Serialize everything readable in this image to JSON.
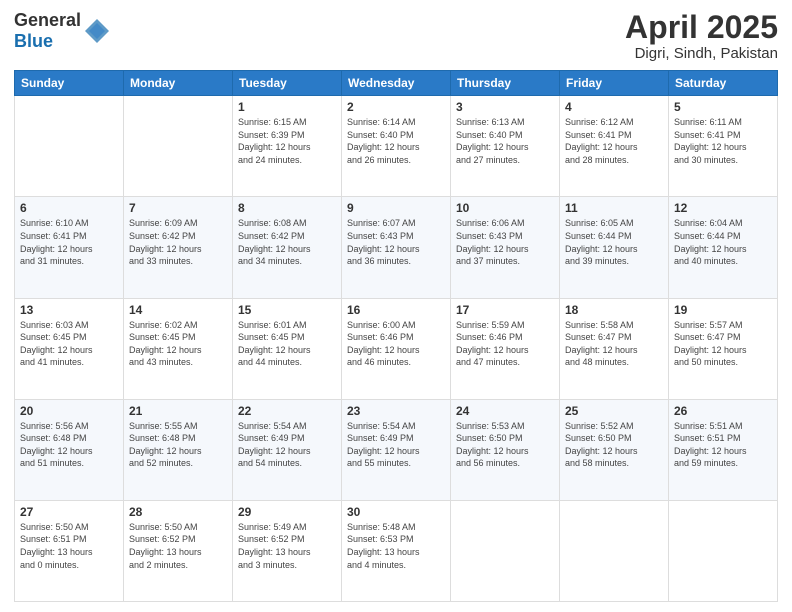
{
  "header": {
    "logo_general": "General",
    "logo_blue": "Blue",
    "title": "April 2025",
    "subtitle": "Digri, Sindh, Pakistan"
  },
  "days_of_week": [
    "Sunday",
    "Monday",
    "Tuesday",
    "Wednesday",
    "Thursday",
    "Friday",
    "Saturday"
  ],
  "weeks": [
    [
      {
        "day": "",
        "info": ""
      },
      {
        "day": "",
        "info": ""
      },
      {
        "day": "1",
        "info": "Sunrise: 6:15 AM\nSunset: 6:39 PM\nDaylight: 12 hours\nand 24 minutes."
      },
      {
        "day": "2",
        "info": "Sunrise: 6:14 AM\nSunset: 6:40 PM\nDaylight: 12 hours\nand 26 minutes."
      },
      {
        "day": "3",
        "info": "Sunrise: 6:13 AM\nSunset: 6:40 PM\nDaylight: 12 hours\nand 27 minutes."
      },
      {
        "day": "4",
        "info": "Sunrise: 6:12 AM\nSunset: 6:41 PM\nDaylight: 12 hours\nand 28 minutes."
      },
      {
        "day": "5",
        "info": "Sunrise: 6:11 AM\nSunset: 6:41 PM\nDaylight: 12 hours\nand 30 minutes."
      }
    ],
    [
      {
        "day": "6",
        "info": "Sunrise: 6:10 AM\nSunset: 6:41 PM\nDaylight: 12 hours\nand 31 minutes."
      },
      {
        "day": "7",
        "info": "Sunrise: 6:09 AM\nSunset: 6:42 PM\nDaylight: 12 hours\nand 33 minutes."
      },
      {
        "day": "8",
        "info": "Sunrise: 6:08 AM\nSunset: 6:42 PM\nDaylight: 12 hours\nand 34 minutes."
      },
      {
        "day": "9",
        "info": "Sunrise: 6:07 AM\nSunset: 6:43 PM\nDaylight: 12 hours\nand 36 minutes."
      },
      {
        "day": "10",
        "info": "Sunrise: 6:06 AM\nSunset: 6:43 PM\nDaylight: 12 hours\nand 37 minutes."
      },
      {
        "day": "11",
        "info": "Sunrise: 6:05 AM\nSunset: 6:44 PM\nDaylight: 12 hours\nand 39 minutes."
      },
      {
        "day": "12",
        "info": "Sunrise: 6:04 AM\nSunset: 6:44 PM\nDaylight: 12 hours\nand 40 minutes."
      }
    ],
    [
      {
        "day": "13",
        "info": "Sunrise: 6:03 AM\nSunset: 6:45 PM\nDaylight: 12 hours\nand 41 minutes."
      },
      {
        "day": "14",
        "info": "Sunrise: 6:02 AM\nSunset: 6:45 PM\nDaylight: 12 hours\nand 43 minutes."
      },
      {
        "day": "15",
        "info": "Sunrise: 6:01 AM\nSunset: 6:45 PM\nDaylight: 12 hours\nand 44 minutes."
      },
      {
        "day": "16",
        "info": "Sunrise: 6:00 AM\nSunset: 6:46 PM\nDaylight: 12 hours\nand 46 minutes."
      },
      {
        "day": "17",
        "info": "Sunrise: 5:59 AM\nSunset: 6:46 PM\nDaylight: 12 hours\nand 47 minutes."
      },
      {
        "day": "18",
        "info": "Sunrise: 5:58 AM\nSunset: 6:47 PM\nDaylight: 12 hours\nand 48 minutes."
      },
      {
        "day": "19",
        "info": "Sunrise: 5:57 AM\nSunset: 6:47 PM\nDaylight: 12 hours\nand 50 minutes."
      }
    ],
    [
      {
        "day": "20",
        "info": "Sunrise: 5:56 AM\nSunset: 6:48 PM\nDaylight: 12 hours\nand 51 minutes."
      },
      {
        "day": "21",
        "info": "Sunrise: 5:55 AM\nSunset: 6:48 PM\nDaylight: 12 hours\nand 52 minutes."
      },
      {
        "day": "22",
        "info": "Sunrise: 5:54 AM\nSunset: 6:49 PM\nDaylight: 12 hours\nand 54 minutes."
      },
      {
        "day": "23",
        "info": "Sunrise: 5:54 AM\nSunset: 6:49 PM\nDaylight: 12 hours\nand 55 minutes."
      },
      {
        "day": "24",
        "info": "Sunrise: 5:53 AM\nSunset: 6:50 PM\nDaylight: 12 hours\nand 56 minutes."
      },
      {
        "day": "25",
        "info": "Sunrise: 5:52 AM\nSunset: 6:50 PM\nDaylight: 12 hours\nand 58 minutes."
      },
      {
        "day": "26",
        "info": "Sunrise: 5:51 AM\nSunset: 6:51 PM\nDaylight: 12 hours\nand 59 minutes."
      }
    ],
    [
      {
        "day": "27",
        "info": "Sunrise: 5:50 AM\nSunset: 6:51 PM\nDaylight: 13 hours\nand 0 minutes."
      },
      {
        "day": "28",
        "info": "Sunrise: 5:50 AM\nSunset: 6:52 PM\nDaylight: 13 hours\nand 2 minutes."
      },
      {
        "day": "29",
        "info": "Sunrise: 5:49 AM\nSunset: 6:52 PM\nDaylight: 13 hours\nand 3 minutes."
      },
      {
        "day": "30",
        "info": "Sunrise: 5:48 AM\nSunset: 6:53 PM\nDaylight: 13 hours\nand 4 minutes."
      },
      {
        "day": "",
        "info": ""
      },
      {
        "day": "",
        "info": ""
      },
      {
        "day": "",
        "info": ""
      }
    ]
  ]
}
